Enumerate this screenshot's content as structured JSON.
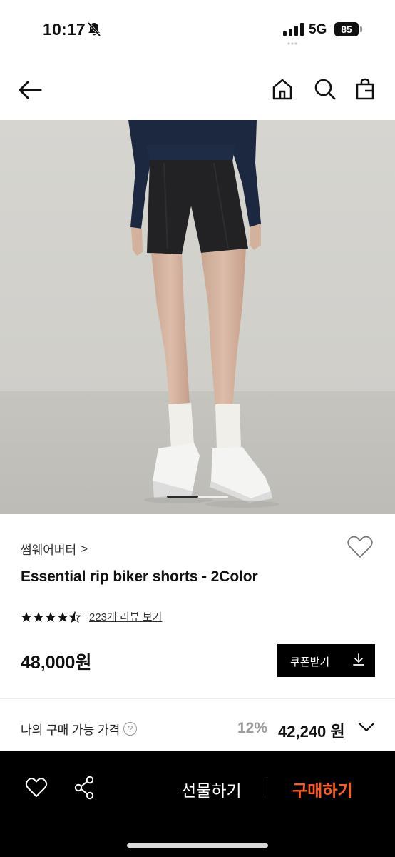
{
  "status_bar": {
    "time": "10:17",
    "network": "5G",
    "battery": "85",
    "battery_level": 0.85
  },
  "icons": {
    "back": "arrow-left-icon",
    "home": "home-icon",
    "search": "search-icon",
    "bag": "shopping-bag-icon",
    "wish": "heart-icon",
    "share": "share-icon",
    "download": "download-icon",
    "expand": "chevron-down-icon"
  },
  "product": {
    "brand": "썸웨어버터",
    "brand_arrow": ">",
    "name": "Essential rip biker shorts - 2Color",
    "rating": 4.5,
    "review_text": "223개 리뷰 보기",
    "price": "48,000원",
    "image_count": 2,
    "image_index": 1
  },
  "coupon": {
    "label": "쿠폰받기"
  },
  "my_price": {
    "label": "나의 구매 가능 가격",
    "help": "?",
    "discount": "12%",
    "price": "42,240 원"
  },
  "bottom_bar": {
    "gift_label": "선물하기",
    "buy_label": "구매하기"
  },
  "colors": {
    "accent": "#ff5a1f",
    "bottom_bar": "#000000",
    "coupon_button": "#000000"
  }
}
